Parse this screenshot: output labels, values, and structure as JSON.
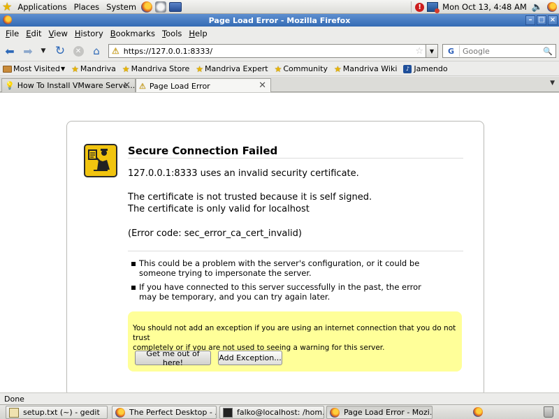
{
  "top_panel": {
    "menus": [
      "Applications",
      "Places",
      "System"
    ],
    "alert_badge": "!",
    "clock": "Mon Oct 13,  4:48 AM"
  },
  "window": {
    "title": "Page Load Error - Mozilla Firefox",
    "btn_min": "–",
    "btn_max": "□",
    "btn_close": "×"
  },
  "menubar": {
    "items": [
      {
        "mnemonic": "F",
        "rest": "ile"
      },
      {
        "mnemonic": "E",
        "rest": "dit"
      },
      {
        "mnemonic": "V",
        "rest": "iew"
      },
      {
        "mnemonic": "H",
        "rest": "istory"
      },
      {
        "mnemonic": "B",
        "rest": "ookmarks"
      },
      {
        "mnemonic": "T",
        "rest": "ools"
      },
      {
        "mnemonic": "H",
        "rest": "elp"
      }
    ]
  },
  "navbar": {
    "url": "https://127.0.0.1:8333/",
    "search_placeholder": "Google",
    "search_engine_glyph": "G"
  },
  "bookmarks": {
    "most_visited": "Most Visited",
    "items": [
      "Mandriva",
      "Mandriva Store",
      "Mandriva Expert",
      "Community",
      "Mandriva Wiki",
      "Jamendo"
    ]
  },
  "tabs": [
    {
      "label": "How To Install VMware Serve..."
    },
    {
      "label": "Page Load Error"
    }
  ],
  "error": {
    "title": "Secure Connection Failed",
    "cert_line": "127.0.0.1:8333 uses an invalid security certificate.",
    "trust_line1": "The certificate is not trusted because it is self signed.",
    "trust_line2": "The certificate is only valid for localhost",
    "code_line": "(Error code: sec_error_ca_cert_invalid)",
    "bullet1_line1": "This could be a problem with the server's configuration, or it could be",
    "bullet1_line2": "someone trying to impersonate the server.",
    "bullet2_line1": "If you have connected to this server successfully in the past, the error",
    "bullet2_line2": "may be temporary, and you can try again later.",
    "warning_line1": "You should not add an exception if you are using an internet connection that you do not trust",
    "warning_line2": "completely or if you are not used to seeing a warning for this server.",
    "btn_get_out": "Get me out of here!",
    "btn_add_exception": "Add Exception..."
  },
  "statusbar": {
    "text": "Done"
  },
  "taskbar": {
    "items": [
      "setup.txt (~) - gedit",
      "The Perfect Desktop - ...",
      "falko@localhost: /hom...",
      "Page Load Error - Mozi..."
    ]
  },
  "colors": {
    "title_bar": "#346bb4",
    "warning_panel": "#ffff99",
    "error_icon": "#f1c40f"
  }
}
